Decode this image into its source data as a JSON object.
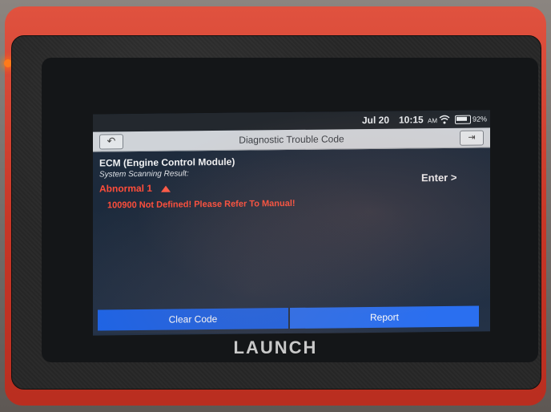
{
  "status_bar": {
    "date": "Jul 20",
    "time": "10:15",
    "ampm": "AM",
    "battery": "92%"
  },
  "title_bar": {
    "title": "Diagnostic Trouble Code"
  },
  "content": {
    "module": "ECM (Engine Control Module)",
    "scan_label": "System Scanning Result:",
    "status": "Abnormal 1",
    "dtc": "100900 Not Defined! Please Refer To Manual!",
    "enter_label": "Enter >"
  },
  "actions": {
    "clear_label": "Clear Code",
    "report_label": "Report"
  },
  "brand": {
    "name": "LAUNCH"
  },
  "colors": {
    "accent_blue": "#1d63e6",
    "error_red": "#ff4d3a",
    "bumper_red": "#d7412f"
  },
  "icons": [
    "back-arrow-icon",
    "exit-icon",
    "wifi-icon",
    "battery-icon",
    "status-arrow-up-icon"
  ]
}
